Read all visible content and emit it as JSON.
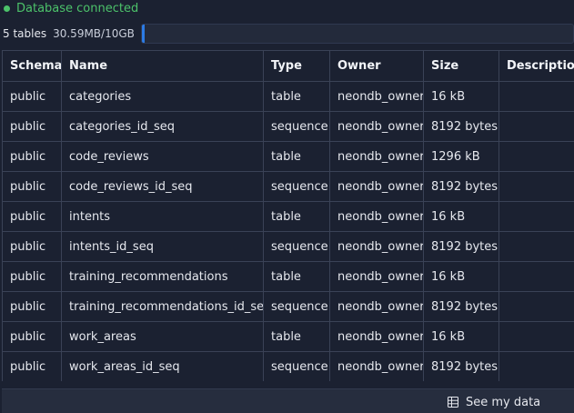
{
  "status": {
    "text": "Database connected",
    "color": "#4cc26a"
  },
  "usage": {
    "tables_label": "5 tables",
    "size_label": "30.59MB/10GB",
    "used_fraction": 0.003
  },
  "table": {
    "headers": [
      "Schema",
      "Name",
      "Type",
      "Owner",
      "Size",
      "Description"
    ],
    "rows": [
      [
        "public",
        "categories",
        "table",
        "neondb_owner",
        "16 kB",
        ""
      ],
      [
        "public",
        "categories_id_seq",
        "sequence",
        "neondb_owner",
        "8192 bytes",
        ""
      ],
      [
        "public",
        "code_reviews",
        "table",
        "neondb_owner",
        "1296 kB",
        ""
      ],
      [
        "public",
        "code_reviews_id_seq",
        "sequence",
        "neondb_owner",
        "8192 bytes",
        ""
      ],
      [
        "public",
        "intents",
        "table",
        "neondb_owner",
        "16 kB",
        ""
      ],
      [
        "public",
        "intents_id_seq",
        "sequence",
        "neondb_owner",
        "8192 bytes",
        ""
      ],
      [
        "public",
        "training_recommendations",
        "table",
        "neondb_owner",
        "16 kB",
        ""
      ],
      [
        "public",
        "training_recommendations_id_seq",
        "sequence",
        "neondb_owner",
        "8192 bytes",
        ""
      ],
      [
        "public",
        "work_areas",
        "table",
        "neondb_owner",
        "16 kB",
        ""
      ],
      [
        "public",
        "work_areas_id_seq",
        "sequence",
        "neondb_owner",
        "8192 bytes",
        ""
      ]
    ]
  },
  "footer": {
    "see_data_label": "See my data",
    "icon": "table-icon"
  },
  "colors": {
    "accent": "#2c7be5",
    "background": "#1b2131"
  }
}
